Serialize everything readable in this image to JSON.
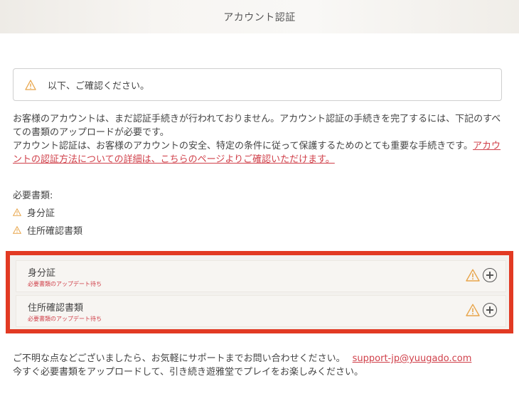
{
  "header": {
    "title": "アカウント認証"
  },
  "notice": {
    "text": "以下、ご確認ください。"
  },
  "description": {
    "line1": "お客様のアカウントは、まだ認証手続きが行われておりません。アカウント認証の手続きを完了するには、下記のすべての書類のアップロードが必要です。",
    "line2": "アカウント認証は、お客様のアカウントの安全、特定の条件に従って保護するためのとても重要な手続きです。",
    "link": "アカウントの認証方法についての詳細は、こちらのページよりご確認いただけます。"
  },
  "required": {
    "title": "必要書類:",
    "items": [
      "身分証",
      "住所確認書類"
    ]
  },
  "documents": [
    {
      "name": "身分証",
      "status": "必要書類のアップデート待ち"
    },
    {
      "name": "住所確認書類",
      "status": "必要書類のアップデート待ち"
    }
  ],
  "footer": {
    "line1": "ご不明な点などございましたら、お気軽にサポートまでお問い合わせください。",
    "email": "support-jp@yuugado.com",
    "line2": "今すぐ必要書類をアップロードして、引き続き遊雅堂でプレイをお楽しみください。"
  },
  "colors": {
    "accent_red": "#d0404a",
    "highlight_border": "#e23a23",
    "warning": "#e8a54a"
  }
}
